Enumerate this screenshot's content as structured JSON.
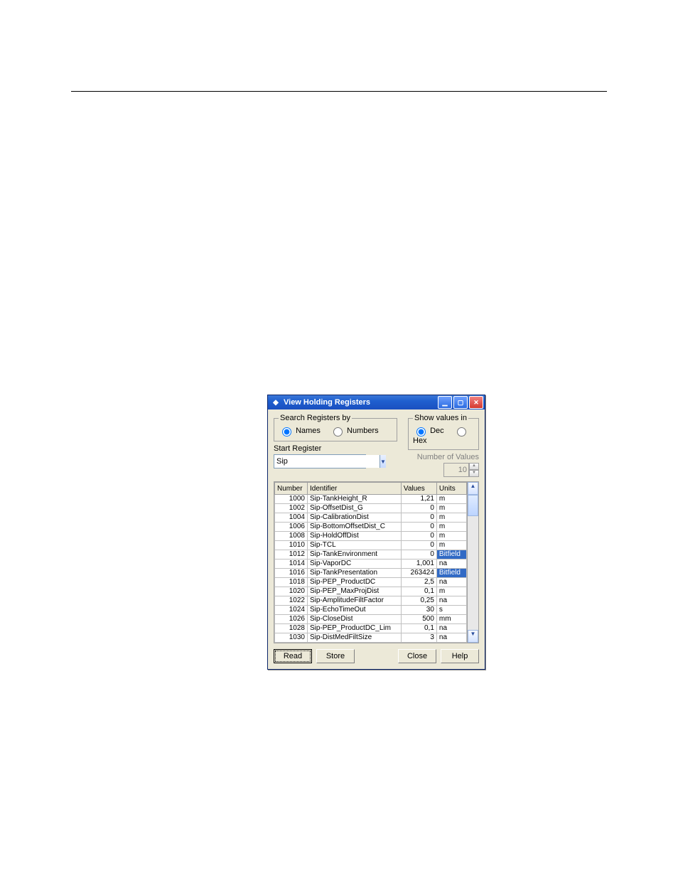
{
  "window_title": "View Holding Registers",
  "search_group": {
    "legend": "Search Registers by",
    "opt_names": "Names",
    "opt_numbers": "Numbers"
  },
  "show_group": {
    "legend": "Show values in",
    "opt_dec": "Dec",
    "opt_hex": "Hex"
  },
  "start_register_label": "Start Register",
  "start_register_value": "Sip",
  "number_of_values_label": "Number of Values",
  "number_of_values_value": "10",
  "table": {
    "headers": {
      "number": "Number",
      "identifier": "Identifier",
      "values": "Values",
      "units": "Units"
    },
    "rows": [
      {
        "num": "1000",
        "id": "Sip-TankHeight_R",
        "val": "1,21",
        "unit": "m",
        "sel": false
      },
      {
        "num": "1002",
        "id": "Sip-OffsetDist_G",
        "val": "0",
        "unit": "m",
        "sel": false
      },
      {
        "num": "1004",
        "id": "Sip-CalibrationDist",
        "val": "0",
        "unit": "m",
        "sel": false
      },
      {
        "num": "1006",
        "id": "Sip-BottomOffsetDist_C",
        "val": "0",
        "unit": "m",
        "sel": false
      },
      {
        "num": "1008",
        "id": "Sip-HoldOffDist",
        "val": "0",
        "unit": "m",
        "sel": false
      },
      {
        "num": "1010",
        "id": "Sip-TCL",
        "val": "0",
        "unit": "m",
        "sel": false
      },
      {
        "num": "1012",
        "id": "Sip-TankEnvironment",
        "val": "0",
        "unit": "Bitfield",
        "sel": true
      },
      {
        "num": "1014",
        "id": "Sip-VaporDC",
        "val": "1,001",
        "unit": "na",
        "sel": false
      },
      {
        "num": "1016",
        "id": "Sip-TankPresentation",
        "val": "263424",
        "unit": "Bitfield",
        "sel": true
      },
      {
        "num": "1018",
        "id": "Sip-PEP_ProductDC",
        "val": "2,5",
        "unit": "na",
        "sel": false
      },
      {
        "num": "1020",
        "id": "Sip-PEP_MaxProjDist",
        "val": "0,1",
        "unit": "m",
        "sel": false
      },
      {
        "num": "1022",
        "id": "Sip-AmplitudeFiltFactor",
        "val": "0,25",
        "unit": "na",
        "sel": false
      },
      {
        "num": "1024",
        "id": "Sip-EchoTimeOut",
        "val": "30",
        "unit": "s",
        "sel": false
      },
      {
        "num": "1026",
        "id": "Sip-CloseDist",
        "val": "500",
        "unit": "mm",
        "sel": false
      },
      {
        "num": "1028",
        "id": "Sip-PEP_ProductDC_Lim",
        "val": "0,1",
        "unit": "na",
        "sel": false
      },
      {
        "num": "1030",
        "id": "Sip-DistMedFiltSize",
        "val": "3",
        "unit": "na",
        "sel": false
      }
    ]
  },
  "buttons": {
    "read": "Read",
    "store": "Store",
    "close": "Close",
    "help": "Help"
  }
}
